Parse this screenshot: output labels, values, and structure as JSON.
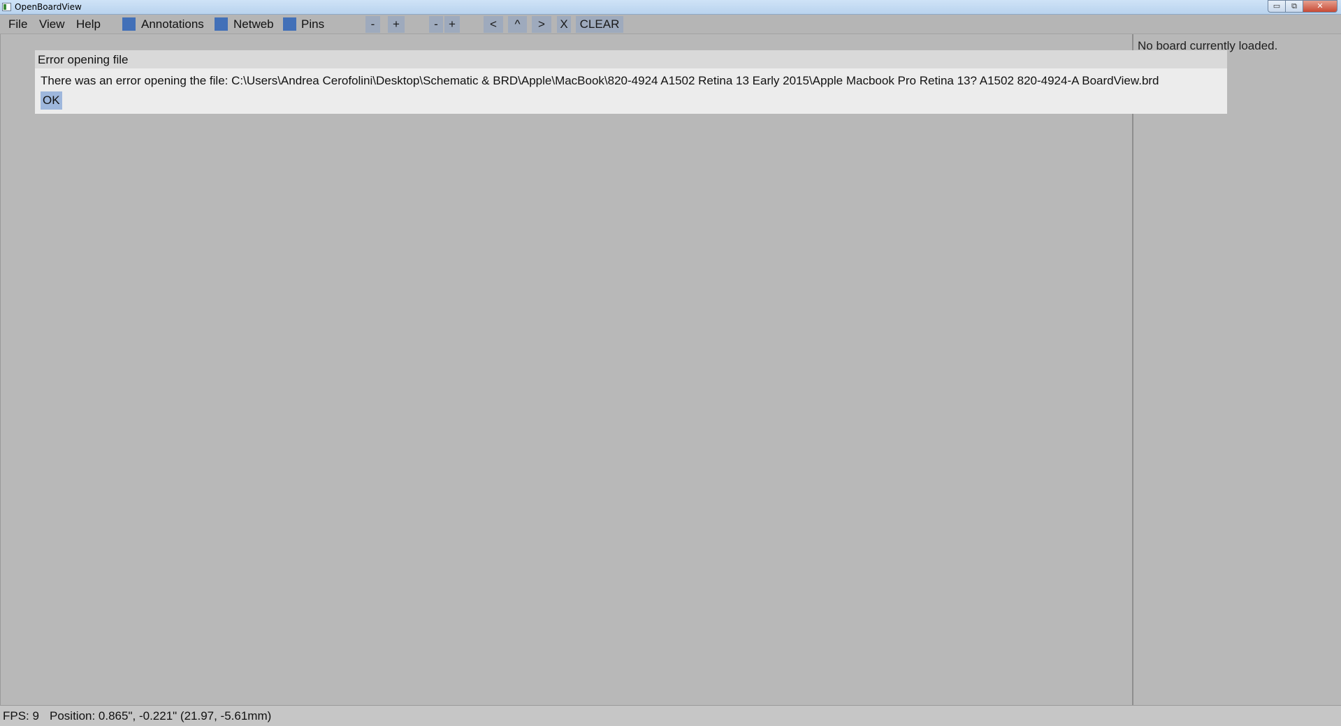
{
  "window": {
    "title": "OpenBoardView",
    "minimize_glyph": "▭",
    "maximize_glyph": "⧉",
    "close_glyph": "✕"
  },
  "menu": {
    "file": "File",
    "view": "View",
    "help": "Help"
  },
  "toolbar": {
    "annotations_label": "Annotations",
    "netweb_label": "Netweb",
    "pins_label": "Pins",
    "zoom_out_1": "-",
    "zoom_in_1": "+",
    "zoom_out_2": "-",
    "zoom_in_2": "+",
    "prev": "<",
    "up": "^",
    "next": ">",
    "close_x": "X",
    "clear": "CLEAR",
    "checkbox_color": "#4270b8"
  },
  "side_panel": {
    "message": "No board currently loaded."
  },
  "dialog": {
    "title": "Error opening file",
    "message": "There was an error opening the file: C:\\Users\\Andrea Cerofolini\\Desktop\\Schematic & BRD\\Apple\\MacBook\\820-4924 A1502 Retina 13 Early 2015\\Apple Macbook Pro Retina 13? A1502 820-4924-A BoardView.brd",
    "ok_label": "OK"
  },
  "status_bar": {
    "fps": "FPS: 9",
    "position": "Position: 0.865\", -0.221\" (21.97, -5.61mm)"
  }
}
